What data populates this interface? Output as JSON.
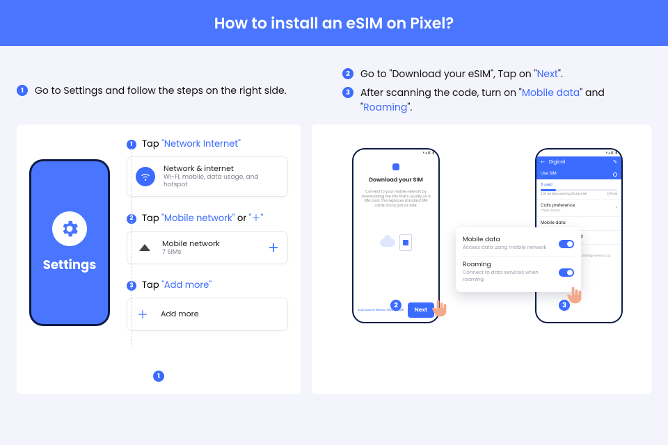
{
  "hero_title": "How to install an eSIM on Pixel?",
  "top": {
    "left": {
      "n": "1",
      "text": "Go to Settings and follow the steps on the right side."
    },
    "right": [
      {
        "n": "2",
        "pre": "Go to \"Download your eSIM\", Tap on \"",
        "hl": "Next",
        "post": "\"."
      },
      {
        "n": "3",
        "pre": "After scanning the code, turn on \"",
        "hl1": "Mobile data",
        "mid": "\" and \"",
        "hl2": "Roaming",
        "post": "\"."
      }
    ]
  },
  "phone_label": "Settings",
  "steps": [
    {
      "n": "1",
      "pre": "Tap ",
      "hl": "\"Network Internet\"",
      "card_title": "Network & internet",
      "card_sub": "Wi-Fi, mobile, data usage, and hotspot"
    },
    {
      "n": "2",
      "pre": "Tap ",
      "hl": "\"Mobile network\"",
      "mid": " or ",
      "hl2": "\"＋\"",
      "card_title": "Mobile network",
      "card_sub": "7 SIMs"
    },
    {
      "n": "3",
      "pre": "Tap ",
      "hl": "\"Add more\"",
      "card_title": "Add more"
    }
  ],
  "panelA_foot": "1",
  "panelB": {
    "left": {
      "title": "Download your SIM",
      "desc": "Connect to your mobile network by downloading the info that's usually on a SIM card. This replaces standard SIM cards and is just as safe.",
      "footer_link": "Scan source license, Privacy path",
      "next": "Next",
      "foot": "2"
    },
    "right": {
      "carrier": "Digicel",
      "use_sim": "Use SIM",
      "gauge_label": "8 used",
      "gauge_left": "2.00 GB data warning\n30 days left",
      "gauge_right": "2.00 GB",
      "opts": [
        {
          "t": "Calls preference",
          "s": "China Unicom"
        },
        {
          "t": "Mobile data",
          "s": ""
        },
        {
          "t": "Data warning & limit",
          "s": ""
        },
        {
          "t": "Advanced",
          "s": "VoLTE, Preferred network type, Settings version, Ca..."
        }
      ],
      "pop": [
        {
          "t": "Mobile data",
          "s": "Access data using mobile network"
        },
        {
          "t": "Roaming",
          "s": "Connect to data services when roaming"
        }
      ],
      "foot": "3"
    }
  }
}
